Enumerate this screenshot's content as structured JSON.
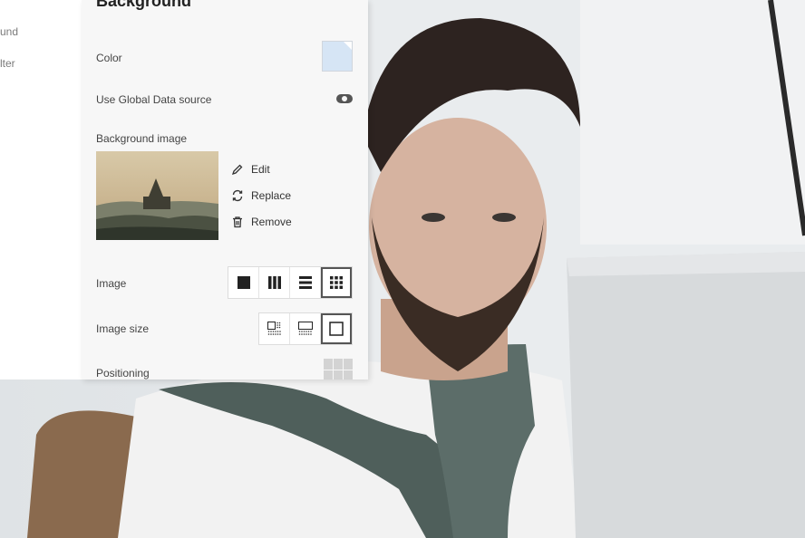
{
  "leftnav": {
    "items": [
      {
        "label": "und"
      },
      {
        "label": "lter"
      }
    ]
  },
  "panel": {
    "title": "Background",
    "color": {
      "label": "Color",
      "value": "#d6e5f5"
    },
    "global_data": {
      "label": "Use Global Data source",
      "enabled": false
    },
    "background_image": {
      "label": "Background image",
      "actions": [
        {
          "label": "Edit",
          "icon": "pencil-icon"
        },
        {
          "label": "Replace",
          "icon": "replace-icon"
        },
        {
          "label": "Remove",
          "icon": "trash-icon"
        }
      ]
    },
    "image_mode": {
      "label": "Image",
      "options": [
        "fill-icon",
        "columns-icon",
        "rows-icon",
        "tile-icon"
      ],
      "selected_index": 3
    },
    "image_size": {
      "label": "Image size",
      "options": [
        "grid-size-icon",
        "fit-width-icon",
        "original-size-icon"
      ],
      "selected_index": 2
    },
    "positioning": {
      "label": "Positioning"
    }
  },
  "colors": {
    "accent": "#555555",
    "panel_bg": "#f7f7f7"
  }
}
